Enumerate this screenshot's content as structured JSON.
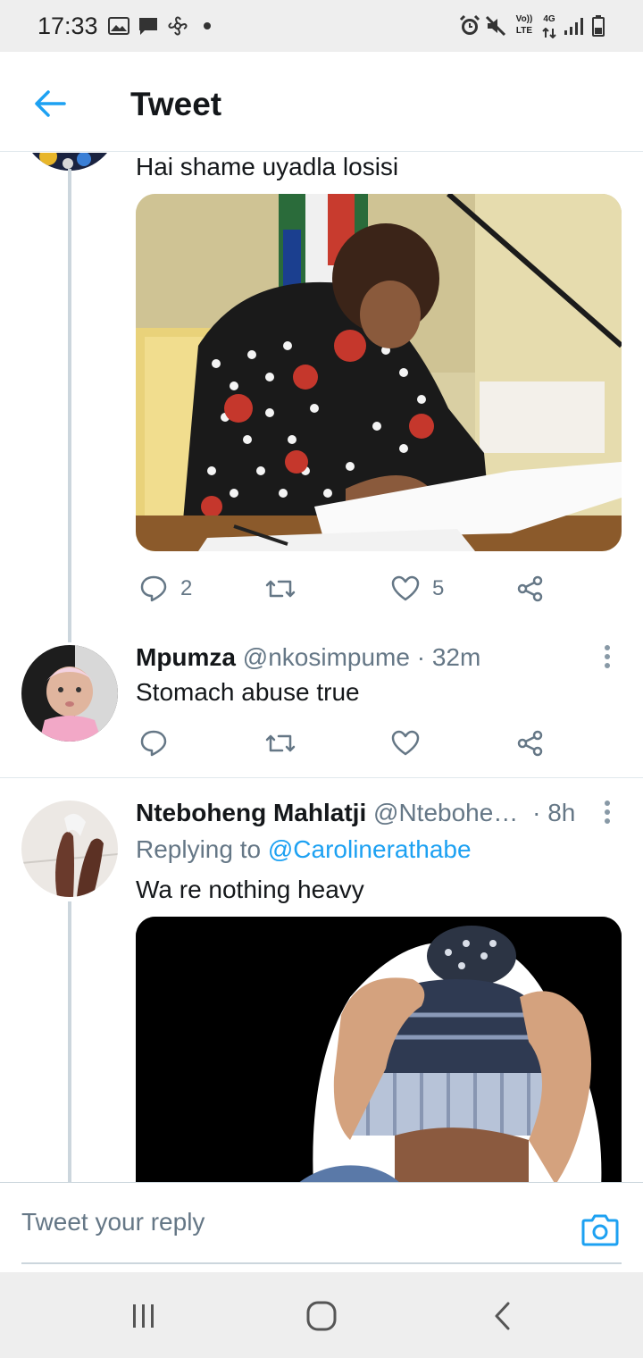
{
  "status_bar": {
    "time": "17:33",
    "left_icons": [
      "image-icon",
      "message-icon",
      "pinwheel-icon",
      "dot-icon"
    ],
    "right_icons": [
      "alarm-icon",
      "mute-icon",
      "volte-icon",
      "4g-icon",
      "signal-icon",
      "battery-icon"
    ],
    "volte_top": "Vo))",
    "volte_bottom": "LTE",
    "net_type": "4G"
  },
  "header": {
    "back_icon": "back-arrow-icon",
    "title": "Tweet"
  },
  "tweets": [
    {
      "text": "Hai shame uyadla losisi",
      "media": "photo: woman in polka-dot floral dress signing documents at a desk",
      "replies": "2",
      "likes": "5"
    },
    {
      "name": "Mpumza",
      "handle": "@nkosimpume",
      "time": "· 32m",
      "text": "Stomach abuse true",
      "avatar": "baby-photo-avatar"
    },
    {
      "name": "Nteboheng Mahlatji",
      "handle": "@Ntebohe…",
      "time": "· 8h",
      "reply_prefix": "Replying to ",
      "reply_handle": "@Carolinerathabe",
      "text": "Wa re nothing heavy",
      "avatar": "legs-photo-avatar",
      "media": "photo: person in knit beanie holding head in hands on black background"
    }
  ],
  "composer": {
    "placeholder": "Tweet your reply",
    "camera_icon": "camera-icon"
  },
  "nav_bar": {
    "buttons": [
      "recent-apps-icon",
      "home-icon",
      "back-icon"
    ]
  },
  "colors": {
    "accent": "#1da1f2",
    "text": "#14171a",
    "secondary": "#657786",
    "divider": "#e1e8ed"
  }
}
